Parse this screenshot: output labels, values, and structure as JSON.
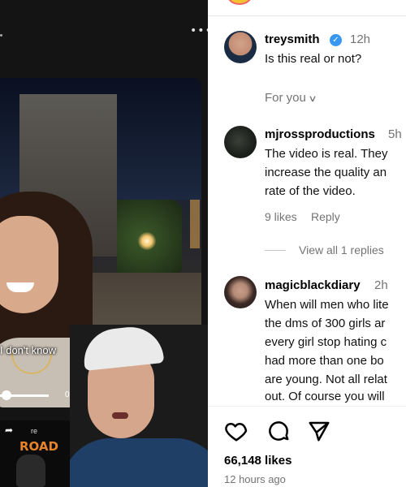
{
  "video": {
    "caption": "I don't know",
    "time": "0:06",
    "progress_fraction": 0.01
  },
  "webcam": {
    "share_label": "re",
    "brand_label": "ROAD"
  },
  "post": {
    "author": "treysmith",
    "author_time": "12h",
    "author_caption": "Is this real or not?",
    "sort_label": "For you",
    "likes": "66,148 likes",
    "posted": "12 hours ago"
  },
  "comments": [
    {
      "username": "mjrossproductions",
      "time": "5h",
      "lines": [
        "The video is real. They",
        "increase the quality an",
        "rate of the video."
      ],
      "likes": "9 likes",
      "reply_label": "Reply",
      "view_replies": "View all 1 replies"
    },
    {
      "username": "magicblackdiary",
      "time": "2h",
      "lines": [
        "When will men who lite",
        "the dms of 300 girls ar",
        "every girl stop hating c",
        "had more than one bo",
        "are young. Not all relat",
        "out. Of course you will"
      ]
    }
  ],
  "icons": {
    "more": "more-dots-icon",
    "verified": "verified-badge-icon",
    "sort": "chevron-down-icon",
    "like": "heart-icon",
    "comment": "comment-bubble-icon",
    "share": "send-icon"
  },
  "colors": {
    "verified_blue": "#3897f0",
    "secondary_text": "#737373",
    "brand_orange": "#e5842a"
  }
}
